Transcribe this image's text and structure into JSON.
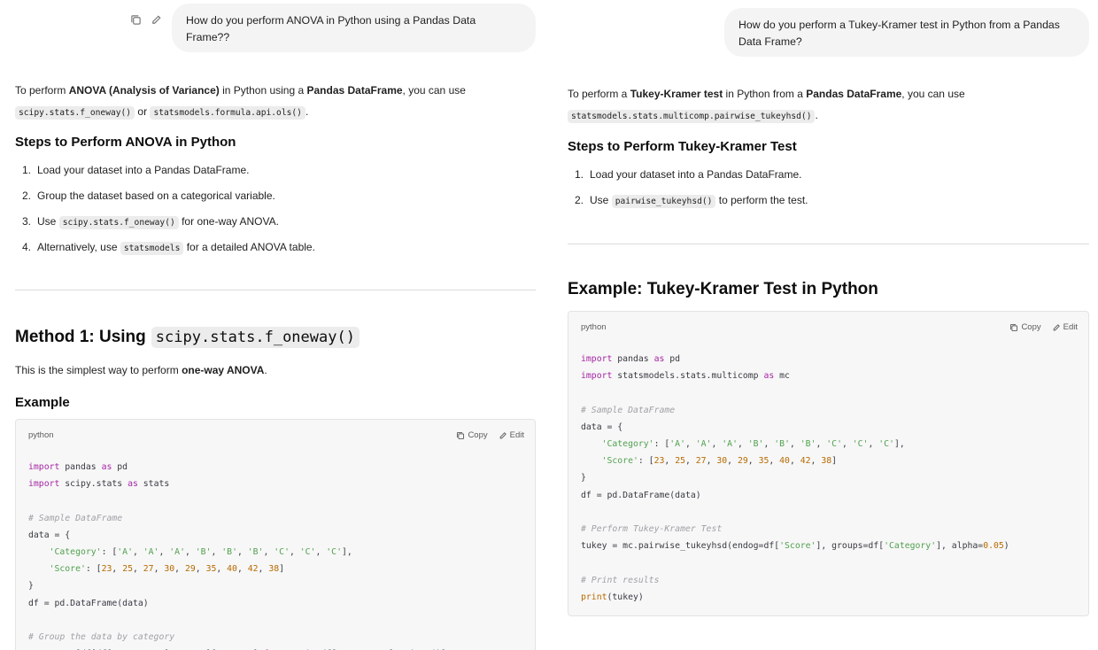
{
  "left": {
    "user_message": "How do you perform ANOVA in Python using a Pandas Data Frame??",
    "intro": {
      "prefix": "To perform ",
      "bold1": "ANOVA (Analysis of Variance)",
      "mid": " in Python using a ",
      "bold2": "Pandas DataFrame",
      "suffix": ", you can use",
      "code1": "scipy.stats.f_oneway()",
      "or": "or",
      "code2": "statsmodels.formula.api.ols()",
      "end": "."
    },
    "steps_heading": "Steps to Perform ANOVA in Python",
    "steps": [
      {
        "num": "1.",
        "text": "Load your dataset into a Pandas DataFrame."
      },
      {
        "num": "2.",
        "text": "Group the dataset based on a categorical variable."
      },
      {
        "num": "3.",
        "pre": "Use ",
        "code": "scipy.stats.f_oneway()",
        "post": " for one-way ANOVA."
      },
      {
        "num": "4.",
        "pre": "Alternatively, use ",
        "code": "statsmodels",
        "post": " for a detailed ANOVA table."
      }
    ],
    "method_heading": "Method 1: Using",
    "method_code": "scipy.stats.f_oneway()",
    "method_desc_prefix": "This is the simplest way to perform ",
    "method_desc_bold": "one-way ANOVA",
    "method_desc_suffix": ".",
    "example_heading": "Example",
    "code_lang": "python",
    "copy_label": "Copy",
    "edit_label": "Edit"
  },
  "right": {
    "user_message": "How do you perform a Tukey-Kramer test in Python from a Pandas Data Frame?",
    "intro": {
      "prefix": "To perform a ",
      "bold1": "Tukey-Kramer test",
      "mid": " in Python from a ",
      "bold2": "Pandas DataFrame",
      "suffix": ", you can use",
      "code1": "statsmodels.stats.multicomp.pairwise_tukeyhsd()",
      "end": "."
    },
    "steps_heading": "Steps to Perform Tukey-Kramer Test",
    "steps": [
      {
        "num": "1.",
        "text": "Load your dataset into a Pandas DataFrame."
      },
      {
        "num": "2.",
        "pre": "Use ",
        "code": "pairwise_tukeyhsd()",
        "post": " to perform the test."
      }
    ],
    "example_heading": "Example: Tukey-Kramer Test in Python",
    "code_lang": "python",
    "copy_label": "Copy",
    "edit_label": "Edit"
  }
}
